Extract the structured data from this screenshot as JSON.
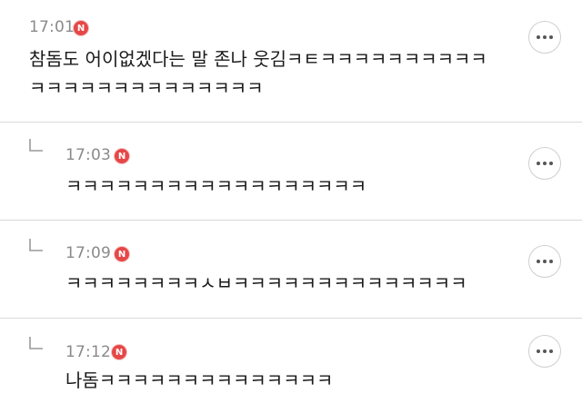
{
  "badge_letter": "N",
  "colors": {
    "badge": "#e64747",
    "divider": "#d9d9d9",
    "time": "#8a8a8a"
  },
  "icons": {
    "reply": "reply-arrow-icon",
    "more": "more-options-icon",
    "badge": "n-badge-icon"
  },
  "comments": [
    {
      "time": "17:01",
      "lines": [
        "참돔도 어이없겠다는 말 존나 웃김ㅋㅌㅋㅋㅋㅋㅋㅋㅋㅋㅋㅋ",
        "ㅋㅋㅋㅋㅋㅋㅋㅋㅋㅋㅋㅋㅋㅋ"
      ],
      "is_reply": false
    },
    {
      "time": "17:03",
      "lines": [
        "ㅋㅋㅋㅋㅋㅋㅋㅋㅋㅋㅋㅋㅋㅋㅋㅋㅋㅋ"
      ],
      "is_reply": true
    },
    {
      "time": "17:09",
      "lines": [
        "ㅋㅋㅋㅋㅋㅋㅋㅋㅅㅂㅋㅋㅋㅋㅋㅋㅋㅋㅋㅋㅋㅋㅋㅋ"
      ],
      "is_reply": true
    },
    {
      "time": "17:12",
      "lines": [
        "나돔ㅋㅋㅋㅋㅋㅋㅋㅋㅋㅋㅋㅋㅋㅋ"
      ],
      "is_reply": true
    }
  ]
}
